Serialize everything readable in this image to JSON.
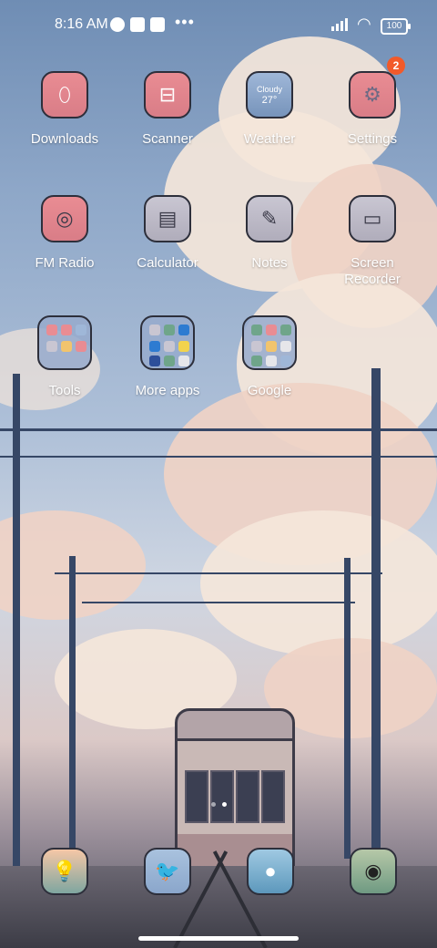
{
  "status_bar": {
    "time": "8:16 AM",
    "battery": "100"
  },
  "apps": [
    {
      "label": "Downloads",
      "icon": "download-egg-icon"
    },
    {
      "label": "Scanner",
      "icon": "scan-icon"
    },
    {
      "label": "Weather",
      "icon": "weather-icon",
      "condition": "Cloudy",
      "temp": "27°"
    },
    {
      "label": "Settings",
      "icon": "gear-icon",
      "badge": "2"
    },
    {
      "label": "FM Radio",
      "icon": "radio-icon"
    },
    {
      "label": "Calculator",
      "icon": "calculator-icon"
    },
    {
      "label": "Notes",
      "icon": "notes-icon"
    },
    {
      "label": "Screen Recorder",
      "icon": "record-icon"
    }
  ],
  "folders": [
    {
      "label": "Tools"
    },
    {
      "label": "More apps"
    },
    {
      "label": "Google"
    }
  ],
  "dock": [
    {
      "icon": "lightbulb-icon"
    },
    {
      "icon": "bird-icon"
    },
    {
      "icon": "chat-bubble-icon"
    },
    {
      "icon": "camera-icon"
    }
  ],
  "colors": {
    "badge": "#f25a2a",
    "tile_pink": "#e98c93",
    "tile_blue": "#9fb7d8",
    "tile_gray": "#c9c6d2"
  }
}
